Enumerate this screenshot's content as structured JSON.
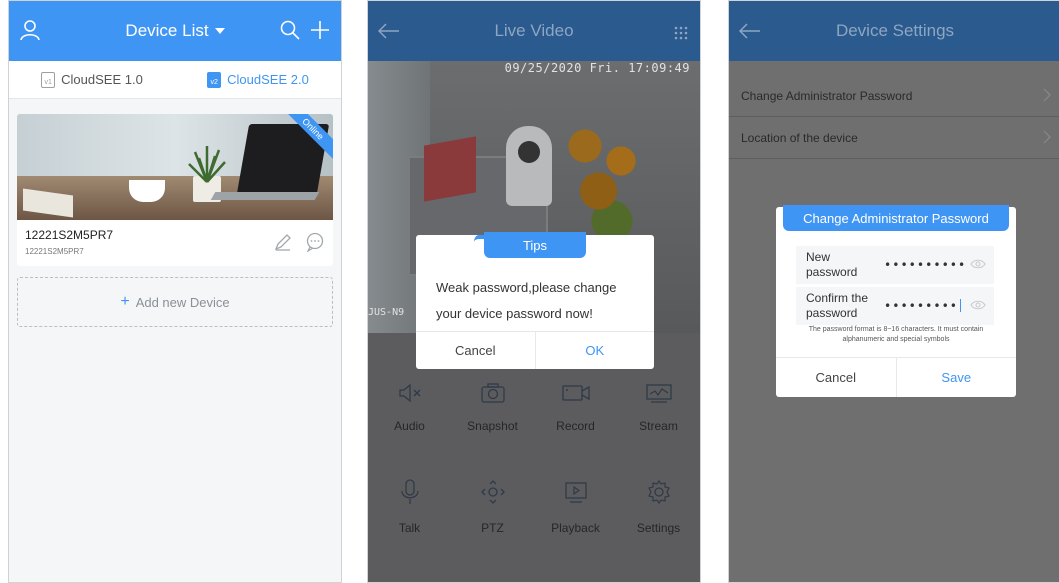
{
  "screen1": {
    "title": "Device List",
    "tabs": [
      {
        "label": "CloudSEE 1.0",
        "icon": "v1"
      },
      {
        "label": "CloudSEE 2.0",
        "icon": "v2"
      }
    ],
    "device": {
      "name": "12221S2M5PR7",
      "sub": "12221S2M5PR7",
      "status": "Online"
    },
    "add_label": "Add new Device"
  },
  "screen2": {
    "title": "Live Video",
    "osd_datetime": "09/25/2020 Fri. 17:09:49",
    "osd_left": "JUS-N9",
    "tips": {
      "title": "Tips",
      "message": "Weak password,please change your device password now!",
      "cancel": "Cancel",
      "ok": "OK"
    },
    "controls": [
      {
        "label": "Audio",
        "icon": "audio-mute-icon"
      },
      {
        "label": "Snapshot",
        "icon": "camera-icon"
      },
      {
        "label": "Record",
        "icon": "record-icon"
      },
      {
        "label": "Stream",
        "icon": "stream-icon"
      },
      {
        "label": "Talk",
        "icon": "microphone-icon"
      },
      {
        "label": "PTZ",
        "icon": "ptz-icon"
      },
      {
        "label": "Playback",
        "icon": "playback-icon"
      },
      {
        "label": "Settings",
        "icon": "gear-icon"
      }
    ]
  },
  "screen3": {
    "title": "Device Settings",
    "rows": [
      {
        "label": "Change Administrator Password"
      },
      {
        "label": "Location of the device"
      }
    ],
    "dialog": {
      "title": "Change Administrator Password",
      "new_label": "New password",
      "new_value": "••••••••••",
      "confirm_label": "Confirm the password",
      "confirm_value": "•••••••••",
      "hint": "The password format is 8~16 characters. It must contain alphanumeric and special symbols",
      "cancel": "Cancel",
      "save": "Save"
    }
  },
  "colors": {
    "accent": "#3f95f4",
    "dim_overlay": "#6f6f70"
  }
}
